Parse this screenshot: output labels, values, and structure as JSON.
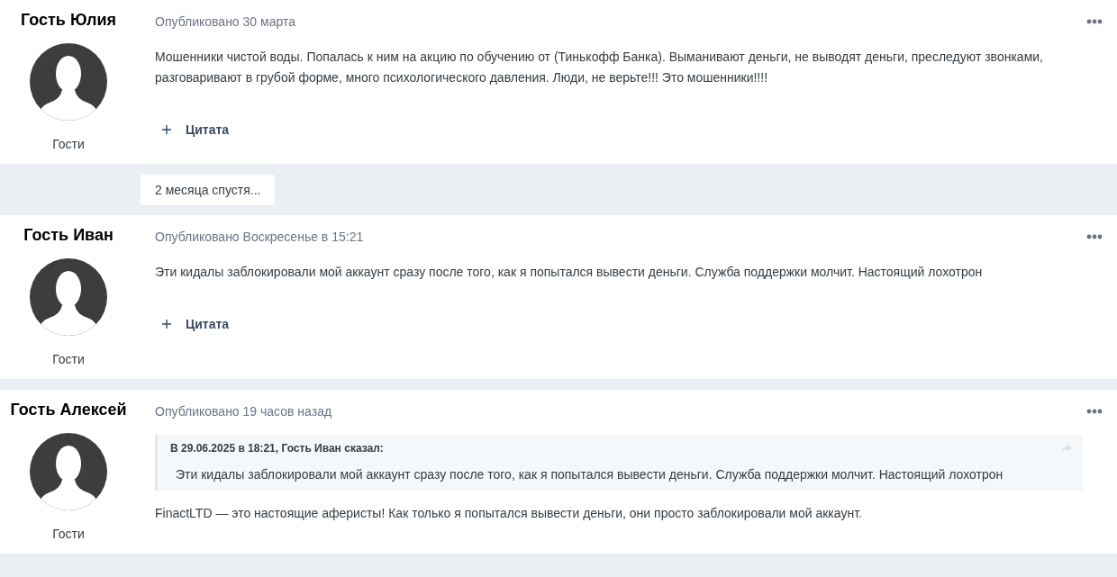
{
  "posts": [
    {
      "author": "Гость Юлия",
      "role": "Гости",
      "date": "Опубликовано 30 марта",
      "body": "Мошенники чистой воды. Попалась к ним на акцию по обучению от (Тинькофф Банка). Выманивают деньги, не выводят деньги, преследуют звонками, разговаривают в грубой форме, много психологического давления. Люди, не верьте!!! Это мошенники!!!!",
      "quote_button": "Цитата"
    },
    {
      "time_gap": "2 месяца спустя...",
      "author": "Гость Иван",
      "role": "Гости",
      "date": "Опубликовано Воскресенье в 15:21",
      "body": "Эти кидалы заблокировали мой аккаунт сразу после того, как я попытался вывести деньги. Служба поддержки молчит. Настоящий лохотрон",
      "quote_button": "Цитата"
    },
    {
      "author": "Гость Алексей",
      "role": "Гости",
      "date": "Опубликовано 19 часов назад",
      "quote": {
        "citation": "В 29.06.2025 в 18:21, Гость Иван сказал:",
        "text": "Эти кидалы заблокировали мой аккаунт сразу после того, как я попытался вывести деньги. Служба поддержки молчит. Настоящий лохотрон"
      },
      "body": "FinactLTD — это настоящие аферисты! Как только я попытался вывести деньги, они просто заблокировали мой аккаунт."
    }
  ]
}
